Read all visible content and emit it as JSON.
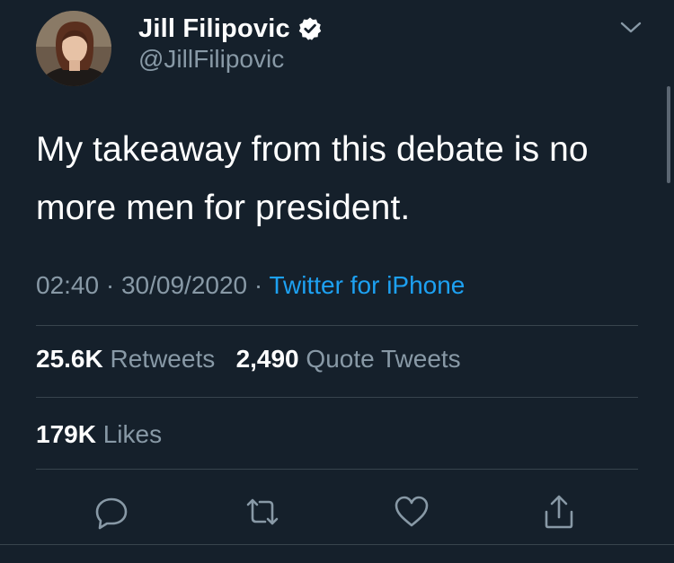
{
  "author": {
    "display_name": "Jill Filipovic",
    "handle": "@JillFilipovic",
    "verified": true,
    "avatar_icon": "profile-photo"
  },
  "tweet": {
    "text_line1": "My takeaway from this debate is no",
    "text_line2": "more men for president.",
    "time": "02:40",
    "separator": "·",
    "date": "30/09/2020",
    "source": "Twitter for iPhone"
  },
  "stats": {
    "retweets_count": "25.6K",
    "retweets_label": "Retweets",
    "quotes_count": "2,490",
    "quotes_label": "Quote Tweets",
    "likes_count": "179K",
    "likes_label": "Likes"
  },
  "actions": {
    "reply_icon": "reply-icon",
    "retweet_icon": "retweet-icon",
    "like_icon": "heart-icon",
    "share_icon": "share-icon"
  },
  "colors": {
    "background": "#15202b",
    "text": "#ffffff",
    "secondary": "#8899a6",
    "accent": "#1da1f2",
    "divider": "#38444d"
  }
}
